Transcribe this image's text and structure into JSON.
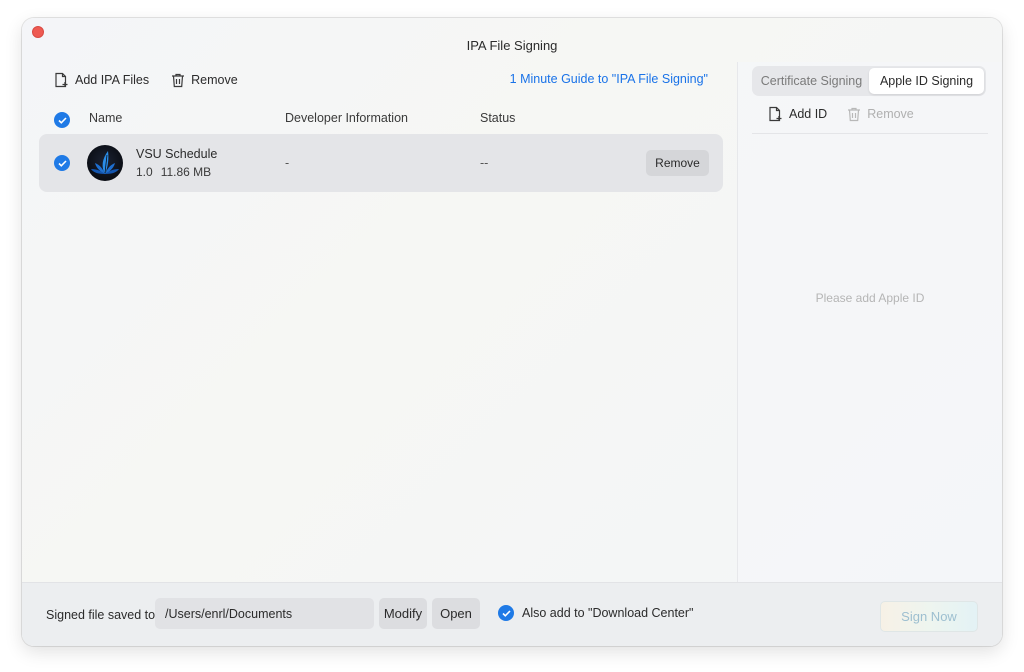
{
  "window": {
    "title": "IPA File Signing"
  },
  "toolbar": {
    "add_ipa_label": "Add IPA Files",
    "remove_label": "Remove",
    "guide_link": "1 Minute Guide to \"IPA File Signing\""
  },
  "table": {
    "columns": [
      "Name",
      "Developer Information",
      "Status"
    ],
    "rows": [
      {
        "checked": true,
        "name": "VSU Schedule",
        "version": "1.0",
        "size": "11.86 MB",
        "developer": "-",
        "status": "--",
        "action_label": "Remove",
        "icon": "feather-leaf-app-icon"
      }
    ]
  },
  "right_panel": {
    "tabs": [
      {
        "label": "Certificate Signing",
        "active": false
      },
      {
        "label": "Apple ID Signing",
        "active": true
      }
    ],
    "add_id_label": "Add ID",
    "remove_label": "Remove",
    "empty_message": "Please add Apple ID"
  },
  "footer": {
    "saved_label": "Signed file saved to",
    "path_value": "/Users/enrl/Documents",
    "modify_label": "Modify",
    "open_label": "Open",
    "also_add_label": "Also add to \"Download Center\"",
    "also_add_checked": true,
    "sign_now_label": "Sign Now"
  },
  "colors": {
    "accent": "#1f7ae6",
    "link": "#1a73e8",
    "close_button": "#ee5a52"
  }
}
